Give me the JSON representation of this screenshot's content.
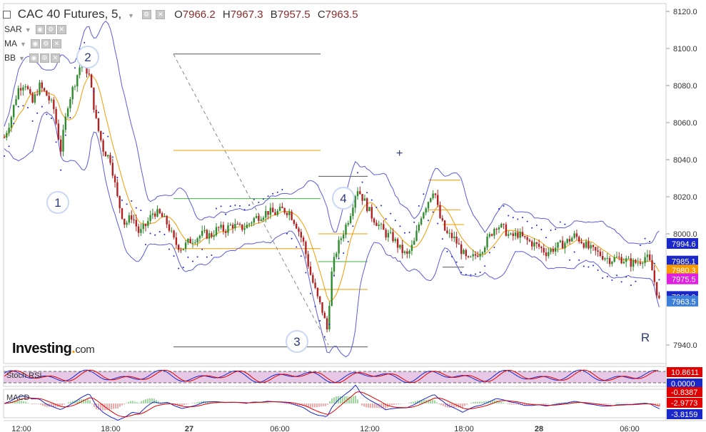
{
  "header": {
    "title": "CAC 40 Futures, 5,",
    "open_label": "O",
    "open": "7966.2",
    "high_label": "H",
    "high": "7967.3",
    "low_label": "B",
    "low": "7957.5",
    "close_label": "C",
    "close": "7963.5"
  },
  "indicators": [
    {
      "name": "SAR"
    },
    {
      "name": "MA"
    },
    {
      "name": "BB"
    }
  ],
  "wave_labels": [
    "1",
    "2",
    "3",
    "4",
    "R"
  ],
  "cursor_symbol": "+",
  "logo": {
    "main": "Investing",
    "suffix": "com"
  },
  "price_axis": [
    "8120.0",
    "8100.0",
    "8080.0",
    "8060.0",
    "8040.0",
    "8020.0",
    "8000.0",
    "7940.0"
  ],
  "price_tags": [
    {
      "value": "7994.6",
      "color": "#1a27c9"
    },
    {
      "value": "7985.1",
      "color": "#1a27c9"
    },
    {
      "value": "7980.3",
      "color": "#f59b00"
    },
    {
      "value": "7975.5",
      "color": "#e020e0"
    },
    {
      "value": "7966.0",
      "color": "#1a27c9"
    },
    {
      "value": "7963.5",
      "color": "#3d7fd9"
    }
  ],
  "time_axis": [
    "12:00",
    "18:00",
    "27",
    "06:00",
    "12:00",
    "18:00",
    "28",
    "06:00"
  ],
  "stoch": {
    "label": "Stoch RSI",
    "values": [
      "10.8611",
      "0.0000"
    ],
    "colors": [
      "#e00000",
      "#1a27c9"
    ]
  },
  "macd": {
    "label": "MACD",
    "values": [
      "-0.8387",
      "-2.9773",
      "-3.8159"
    ],
    "colors": [
      "#e00000",
      "#e00000",
      "#1a27c9"
    ]
  },
  "colors": {
    "up": "#2e8b2e",
    "down": "#b22222",
    "band": "#5b5bdc",
    "sar": "#1a27c9",
    "ma": "#f59b00",
    "fib_orange": "#f59b00",
    "fib_green": "#3cb43c",
    "wave_circle": "#c9d9f5",
    "wave_text": "#2c3a7a"
  }
}
